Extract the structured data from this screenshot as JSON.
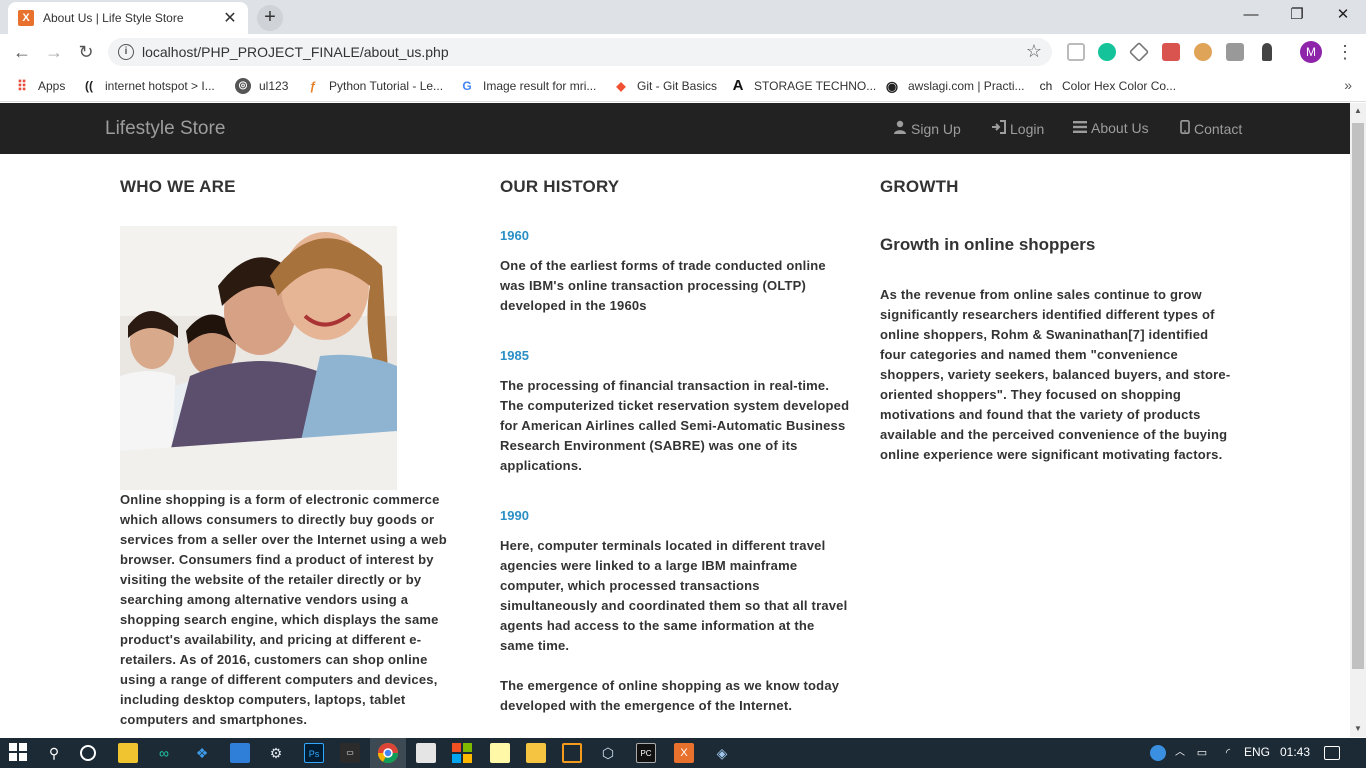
{
  "browser": {
    "tab_title": "About Us | Life Style Store",
    "tab_close": "✕",
    "new_tab": "+",
    "favicon_text": "X",
    "url": "localhost/PHP_PROJECT_FINALE/about_us.php",
    "window_controls": [
      "—",
      "❐",
      "✕"
    ],
    "profile_initial": "M",
    "bookmarks": [
      {
        "label": "Apps",
        "icon": "apps-grid-icon"
      },
      {
        "label": "internet hotspot > I...",
        "icon": "hotspot-icon"
      },
      {
        "label": "ul123",
        "icon": "globe-icon"
      },
      {
        "label": "Python Tutorial - Le...",
        "icon": "python-icon"
      },
      {
        "label": "Image result for mri...",
        "icon": "google-icon"
      },
      {
        "label": "Git - Git Basics",
        "icon": "git-icon"
      },
      {
        "label": "STORAGE TECHNO...",
        "icon": "a-letter-icon"
      },
      {
        "label": "awslagi.com | Practi...",
        "icon": "record-icon"
      },
      {
        "label": "Color Hex Color Co...",
        "icon": "ch-icon"
      }
    ]
  },
  "site": {
    "brand": "Lifestyle Store",
    "nav": [
      {
        "label": "Sign Up",
        "icon": "user-icon"
      },
      {
        "label": "Login",
        "icon": "login-icon"
      },
      {
        "label": "About Us",
        "icon": "list-icon"
      },
      {
        "label": "Contact",
        "icon": "phone-icon"
      }
    ]
  },
  "who_we_are": {
    "heading": "WHO WE ARE",
    "text": "Online shopping is a form of electronic commerce which allows consumers to directly buy goods or services from a seller over the Internet using a web browser. Consumers find a product of interest by visiting the website of the retailer directly or by searching among alternative vendors using a shopping search engine, which displays the same product's availability, and pricing at different e-retailers. As of 2016, customers can shop online using a range of different computers and devices, including desktop computers, laptops, tablet computers and smartphones."
  },
  "our_history": {
    "heading": "OUR HISTORY",
    "entries": [
      {
        "year": "1960",
        "text": "One of the earliest forms of trade conducted online was IBM's online transaction processing (OLTP) developed in the 1960s"
      },
      {
        "year": "1985",
        "text": "The processing of financial transaction in real-time. The computerized ticket reservation system developed for American Airlines called Semi-Automatic Business Research Environment (SABRE) was one of its applications."
      },
      {
        "year": "1990",
        "text": "Here, computer terminals located in different travel agencies were linked to a large IBM mainframe computer, which processed transactions simultaneously and coordinated them so that all travel agents had access to the same information at the same time."
      }
    ],
    "closing": "The emergence of online shopping as we know today developed with the emergence of the Internet."
  },
  "growth": {
    "heading": "GROWTH",
    "subheading": "Growth in online shoppers",
    "text": "As the revenue from online sales continue to grow significantly researchers identified different types of online shoppers, Rohm & Swaninathan[7] identified four categories and named them \"convenience shoppers, variety seekers, balanced buyers, and store-oriented shoppers\". They focused on shopping motivations and found that the variety of products available and the perceived convenience of the buying online experience were significant motivating factors."
  },
  "taskbar": {
    "language": "ENG",
    "time": "01:43"
  }
}
